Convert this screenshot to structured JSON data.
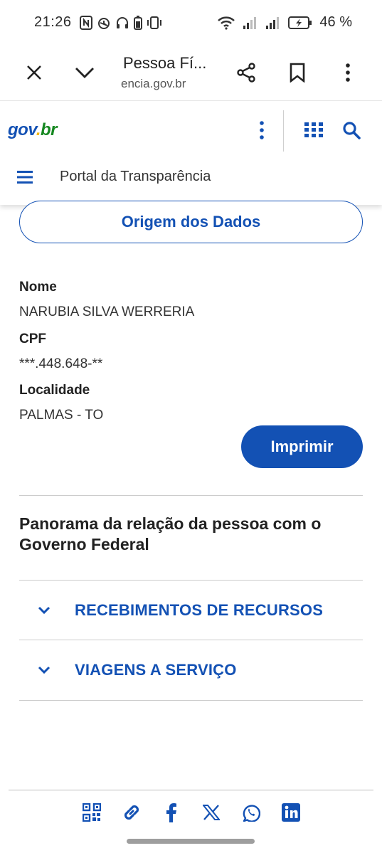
{
  "status_bar": {
    "time": "21:26",
    "battery_percent": "46 %"
  },
  "browser": {
    "title": "Pessoa Fí...",
    "url": "encia.gov.br"
  },
  "header": {
    "logo_part1": "gov",
    "logo_part2": ".",
    "logo_part3": "br",
    "portal_label": "Portal da Transparência"
  },
  "main": {
    "origem_button": "Origem dos Dados",
    "fields": [
      {
        "label": "Nome",
        "value": "NARUBIA SILVA WERRERIA"
      },
      {
        "label": "CPF",
        "value": "***.448.648-**"
      },
      {
        "label": "Localidade",
        "value": "PALMAS - TO"
      }
    ],
    "print_button": "Imprimir",
    "panorama_title": "Panorama da relação da pessoa com o Governo Federal",
    "accordion": [
      {
        "label": "RECEBIMENTOS DE RECURSOS"
      },
      {
        "label": "VIAGENS A SERVIÇO"
      }
    ]
  },
  "colors": {
    "primary": "#1351b4",
    "logo_yellow": "#f2b60b",
    "logo_green": "#168821"
  }
}
